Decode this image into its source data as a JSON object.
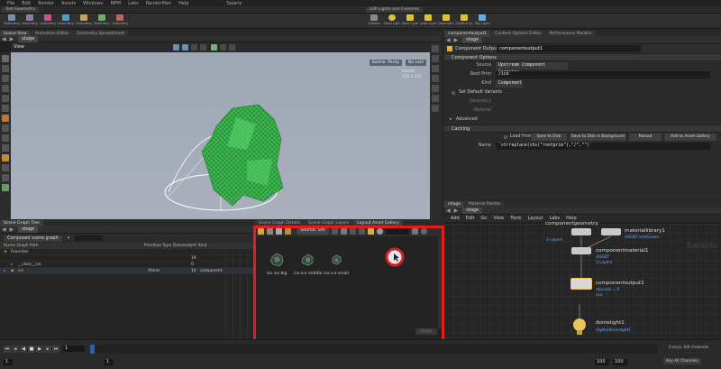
{
  "menubar": [
    "File",
    "Edit",
    "Render",
    "Assets",
    "Windows",
    "MPM",
    "Labs",
    "RenderMan",
    "Help"
  ],
  "desktop": "Solaris",
  "shelf_tabs": [
    "Test Geometry",
    "LOP Lights and Cameras"
  ],
  "shelf_left": [
    "Geometry 1",
    "Geometry 2",
    "Geometry 3",
    "Geometry 4",
    "Geometry 5",
    "Geometry 6",
    "Geometry 7"
  ],
  "shelf_right": [
    "Camera",
    "Point Light",
    "Spot Light",
    "Area Light",
    "Geometry Light",
    "Distant Light",
    "Sky Light"
  ],
  "viewer": {
    "tabs": [
      "Scene View",
      "Animation Editor",
      "Geometry Spreadsheet"
    ],
    "path": "stage",
    "label": "View",
    "cam_menu": "Karma: Persp",
    "cam_select": "No cam",
    "overlay_line1": "Karma",
    "overlay_line2": "112 x 337"
  },
  "scene_tree": {
    "tabs": [
      "Scene Graph Tree"
    ],
    "path": "stage",
    "mode": "Composed scene graph",
    "columns": [
      "Scene Graph Path",
      "Primitive Type",
      "Descendant",
      "Kind"
    ],
    "rows": [
      {
        "name": "Favorites",
        "type": "",
        "count": "",
        "kind": ""
      },
      {
        "name": "",
        "type": "",
        "count": "19",
        "kind": ""
      },
      {
        "name": "__class__ice",
        "type": "",
        "count": "0",
        "kind": ""
      },
      {
        "name": "ice",
        "type": "Xform",
        "count": "14",
        "kind": "component"
      }
    ]
  },
  "gallery": {
    "tabs": [
      "Scene Graph Details",
      "Scene Graph Layers",
      "Layout Asset Gallery"
    ],
    "source": "Source: SHI",
    "items": [
      "ice ice big",
      "ice ice middle",
      "ice ice small"
    ],
    "apply": "Apply"
  },
  "params": {
    "tabs": [
      "componentoutput1",
      "Content Options Editor",
      "Performance Monitor"
    ],
    "path": "stage",
    "node_type": "Component Output",
    "node_name": "componentoutput1",
    "section_options": "Component Options",
    "source_label": "Source",
    "source_value": "Upstream Component Geometry",
    "root_label": "Root Prim",
    "root_value": "/ice",
    "kind_label": "Kind",
    "kind_value": "Component",
    "default_variants": "Set Default Variants",
    "geometry_label": "Geometry",
    "material_label": "Material",
    "advanced": "Advanced",
    "caching": "Caching",
    "load_from": "Load from",
    "btn_save": "Save to Disk",
    "btn_save_bg": "Save to Disk in Background",
    "btn_reload": "Reload",
    "btn_gallery": "Add to Asset Gallery",
    "name_label": "Name",
    "name_value": "`strreplace(chs(\"rootprim\"),\"/\",\"\")`"
  },
  "network": {
    "tabs": [
      "/stage",
      "Material Palette"
    ],
    "path": "stage",
    "menu": [
      "Add",
      "Edit",
      "Go",
      "View",
      "Tools",
      "Layout",
      "Labs",
      "Help"
    ],
    "watermark": "Solaris",
    "nodes": [
      {
        "name": "componentgeometry",
        "sub1": "/ASSET",
        "sub2": "3 Layers"
      },
      {
        "name": "materiallibrary1",
        "sub1": "/ASSET/mtl/Green",
        "sub2": ""
      },
      {
        "name": "componentmaterial1",
        "sub1": "/ASSET",
        "sub2": "3 Layers"
      },
      {
        "name": "componentoutput1",
        "sub1": "ropcook = 0",
        "sub2": "/ice"
      },
      {
        "name": "domelight1",
        "sub1": "/lights/domelight1",
        "sub2": ""
      }
    ]
  },
  "timeline": {
    "current_frame": "1",
    "start": "1",
    "start2": "1",
    "end": "100",
    "end2": "100",
    "keys_info": "0 keys, 0/0 channels",
    "key_all": "Key All Channels"
  },
  "colors": {
    "highlight": "#e31b23",
    "mesh": "#3fbf52",
    "viewport_bg": "#a4abb8",
    "node_yellow": "#e8c65a"
  }
}
